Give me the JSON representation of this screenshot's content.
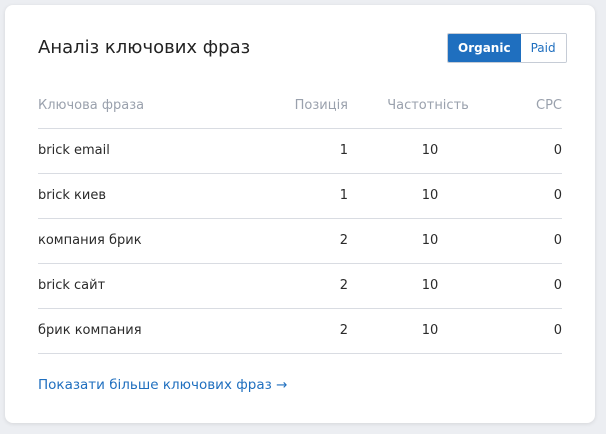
{
  "card": {
    "title": "Аналіз ключових фраз",
    "toggle": {
      "organic_label": "Organic",
      "paid_label": "Paid"
    },
    "table": {
      "headers": {
        "phrase": "Ключова фраза",
        "position": "Позиція",
        "frequency": "Частотність",
        "cpc": "CPC"
      },
      "rows": [
        {
          "phrase": "brick email",
          "position": "1",
          "frequency": "10",
          "cpc": "0"
        },
        {
          "phrase": "brick киев",
          "position": "1",
          "frequency": "10",
          "cpc": "0"
        },
        {
          "phrase": "компания брик",
          "position": "2",
          "frequency": "10",
          "cpc": "0"
        },
        {
          "phrase": "brick сайт",
          "position": "2",
          "frequency": "10",
          "cpc": "0"
        },
        {
          "phrase": "брик компания",
          "position": "2",
          "frequency": "10",
          "cpc": "0"
        }
      ]
    },
    "more_link": "Показати більше ключових фраз →"
  },
  "colors": {
    "accent": "#1f6fbf",
    "text": "#222222",
    "muted": "#9aa1ad",
    "divider": "#d9dce2"
  }
}
